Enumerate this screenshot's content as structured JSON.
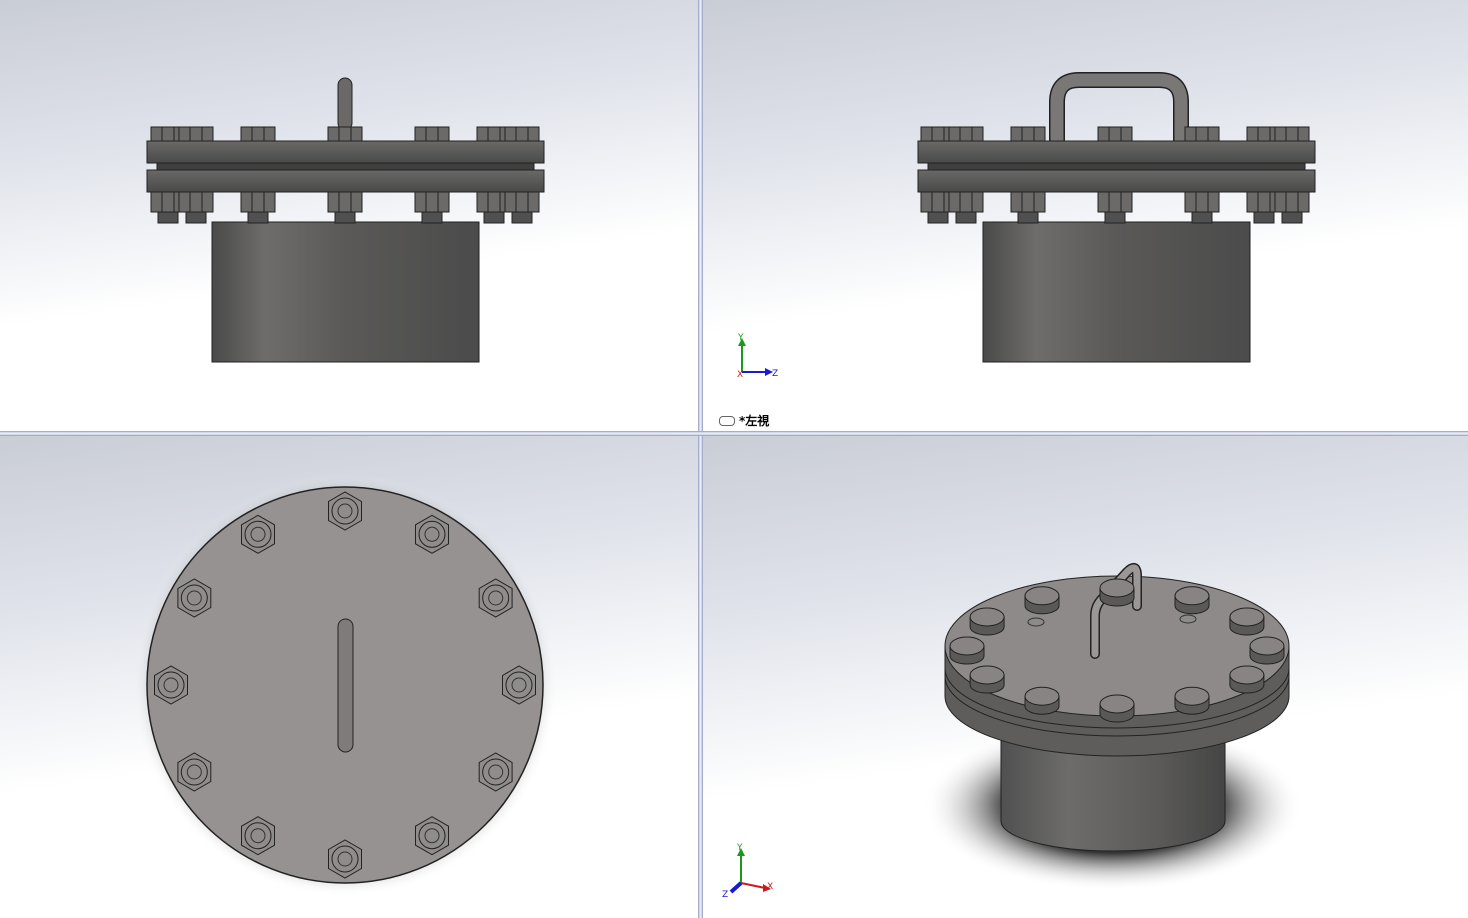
{
  "viewports": {
    "top_left": {
      "name": "front-view"
    },
    "top_right": {
      "name": "left-view",
      "label": "*左視"
    },
    "bottom_left": {
      "name": "top-view"
    },
    "bottom_right": {
      "name": "isometric-view"
    }
  },
  "triad": {
    "axis_y": "Y",
    "axis_z": "Z",
    "axis_x": "X",
    "colors": {
      "y": "#1a9a1a",
      "z": "#1a1ad0",
      "x": "#d01a1a"
    }
  },
  "model": {
    "bolt_count": 12,
    "body_color": "#555555",
    "plate_color": "#959291"
  }
}
